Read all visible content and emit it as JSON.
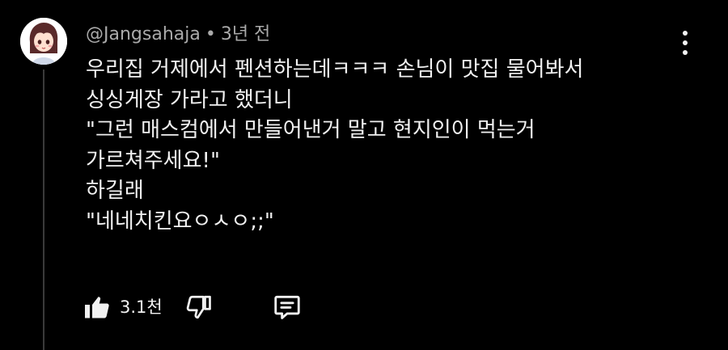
{
  "comment": {
    "author": "@Jangsahaja",
    "separator": "•",
    "time": "3년 전",
    "lines": [
      "우리집 거제에서 펜션하는데ㅋㅋㅋ 손님이 맛집 물어봐서",
      "싱싱게장 가라고 했더니",
      "\"그런 매스컴에서 만들어낸거 말고 현지인이 먹는거",
      "가르쳐주세요!\"",
      "하길래",
      "\"네네치킨요ㅇㅅㅇ;;\""
    ]
  },
  "actions": {
    "like_count": "3.1천",
    "icons": {
      "like": "thumbs-up-icon",
      "dislike": "thumbs-down-icon",
      "reply": "comment-icon",
      "more": "more-vertical-icon"
    }
  },
  "colors": {
    "background": "#000000",
    "text": "#f1f1f1",
    "meta": "#aaaaaa"
  }
}
